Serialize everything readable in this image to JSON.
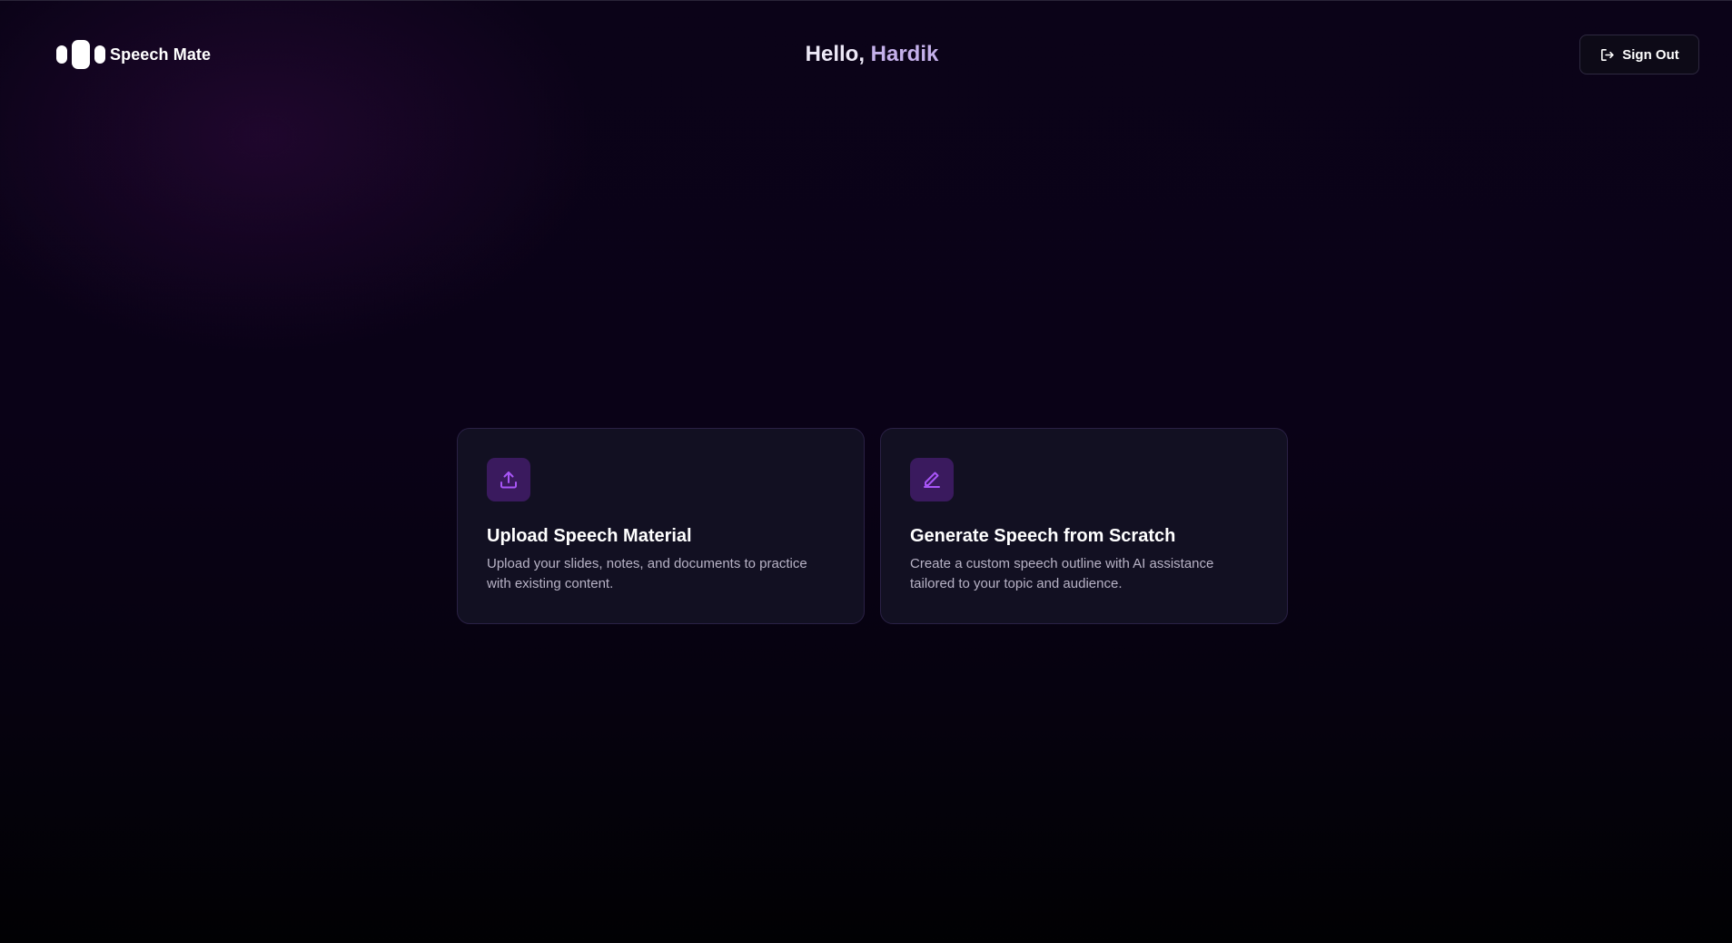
{
  "header": {
    "brand_name": "Speech Mate",
    "greeting_prefix": "Hello, ",
    "user_name": "Hardik",
    "signout_label": "Sign Out",
    "signout_icon": "log-out-icon"
  },
  "cards": [
    {
      "icon": "upload-icon",
      "title": "Upload Speech Material",
      "description": "Upload your slides, notes, and documents to practice with existing content."
    },
    {
      "icon": "pencil-icon",
      "title": "Generate Speech from Scratch",
      "description": "Create a custom speech outline with AI assistance tailored to your topic and audience."
    }
  ],
  "colors": {
    "background": "#0a0217",
    "accent": "#a855f7",
    "icon_box": "#3a1a5e",
    "card": "#141124",
    "user_name": "#c4b0ea"
  }
}
